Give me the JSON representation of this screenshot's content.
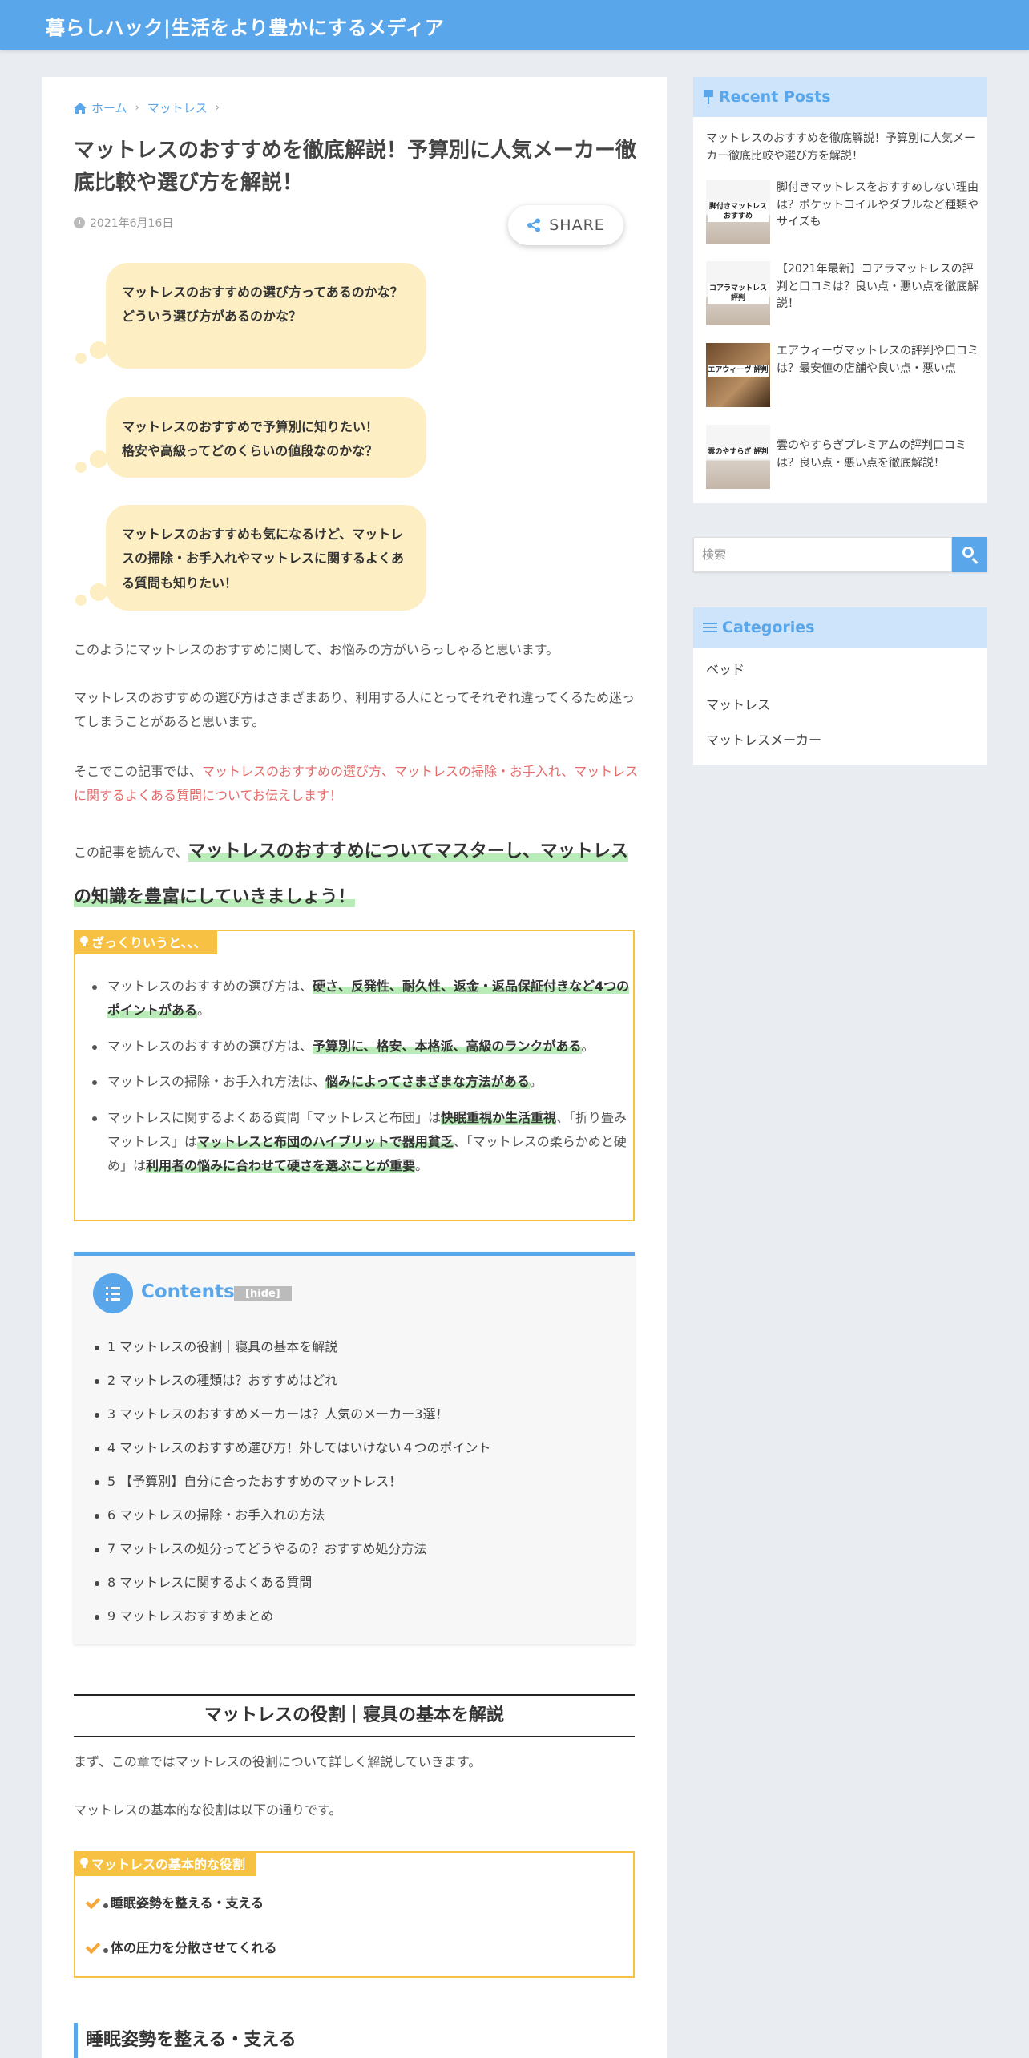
{
  "site": {
    "title": "暮らしハック|生活をより豊かにするメディア"
  },
  "breadcrumb": {
    "home": "ホーム",
    "category": "マットレス"
  },
  "article": {
    "title": "マットレスのおすすめを徹底解説！予算別に人気メーカー徹底比較や選び方を解説！",
    "date": "2021年6月16日",
    "share_label": "SHARE",
    "bubbles": [
      [
        "マットレスのおすすめの選び方ってあるのかな？",
        "どういう選び方があるのかな？"
      ],
      [
        "マットレスのおすすめで予算別に知りたい！",
        "格安や高級ってどのくらいの値段なのかな？"
      ],
      [
        "マットレスのおすすめも気になるけど、マットレスの掃除・お手入れやマットレスに関するよくある質問も知りたい！"
      ]
    ],
    "para1": "このようにマットレスのおすすめに関して、お悩みの方がいらっしゃると思います。",
    "para2": "マットレスのおすすめの選び方はさまざまあり、利用する人にとってそれぞれ違ってくるため迷ってしまうことがあると思います。",
    "para3_prefix": "そこでこの記事では、",
    "para3_red": "マットレスのおすすめの選び方、マットレスの掃除・お手入れ、マットレスに関するよくある質問についてお伝えします！",
    "lead_prefix": "この記事を読んで、",
    "lead_big": "マットレスのおすすめについてマスターし、マットレスの知識を豊富にしていきましょう！",
    "summary": {
      "label": "ざっくりいうと、、、",
      "items": [
        {
          "pre": "マットレスのおすすめの選び方は、",
          "mark": "硬さ、反発性、耐久性、返金・返品保証付きなど4つのポイントがある",
          "post": "。"
        },
        {
          "pre": "マットレスのおすすめの選び方は、",
          "mark": "予算別に、格安、本格派、高級のランクがある",
          "post": "。"
        },
        {
          "pre": "マットレスの掃除・お手入れ方法は、",
          "mark": "悩みによってさまざまな方法がある",
          "post": "。"
        }
      ],
      "item4": {
        "a": "マットレスに関するよくある質問「マットレスと布団」は",
        "b": "快眠重視か生活重視",
        "c": "、「折り畳みマットレス」は",
        "d": "マットレスと布団のハイブリットで器用貧乏",
        "e": "、「マットレスの柔らかめと硬め」は",
        "f": "利用者の悩みに合わせて硬さを選ぶことが重要",
        "g": "。"
      }
    },
    "toc": {
      "title": "Contents",
      "hide_label": "[hide]",
      "items": [
        "1 マットレスの役割｜寝具の基本を解説",
        "2 マットレスの種類は？おすすめはどれ",
        "3 マットレスのおすすめメーカーは？人気のメーカー3選！",
        "4 マットレスのおすすめ選び方！外してはいけない４つのポイント",
        "5 【予算別】自分に合ったおすすめのマットレス！",
        "6 マットレスの掃除・お手入れの方法",
        "7 マットレスの処分ってどうやるの？おすすめ処分方法",
        "8 マットレスに関するよくある質問",
        "9 マットレスおすすめまとめ"
      ]
    },
    "h2": "マットレスの役割｜寝具の基本を解説",
    "para4": "まず、この章ではマットレスの役割について詳しく解説していきます。",
    "para5": "マットレスの基本的な役割は以下の通りです。",
    "roles": {
      "label": "マットレスの基本的な役割",
      "items": [
        "睡眠姿勢を整える・支える",
        "体の圧力を分散させてくれる"
      ]
    },
    "h3": "睡眠姿勢を整える・支える"
  },
  "sidebar": {
    "recent_title": "Recent Posts",
    "first_post": "マットレスのおすすめを徹底解説！予算別に人気メーカー徹底比較や選び方を解説！",
    "posts": [
      {
        "thumb": "脚付きマットレス おすすめ",
        "title": "脚付きマットレスをおすすめしない理由は？ポケットコイルやダブルなど種類やサイズも"
      },
      {
        "thumb": "コアラマットレス 評判",
        "title": "【2021年最新】コアラマットレスの評判と口コミは？良い点・悪い点を徹底解説！"
      },
      {
        "thumb": "エアウィーヴ 評判",
        "title": "エアウィーヴマットレスの評判や口コミは？最安値の店舗や良い点・悪い点"
      },
      {
        "thumb": "雲のやすらぎ 評判",
        "title": "雲のやすらぎプレミアムの評判口コミは？良い点・悪い点を徹底解説！"
      }
    ],
    "search_placeholder": "検索",
    "categories_title": "Categories",
    "categories": [
      "ベッド",
      "マットレス",
      "マットレスメーカー"
    ]
  },
  "colors": {
    "accent": "#5aa6ea",
    "bubble": "#fdefc3",
    "box_border": "#f7c244",
    "marker": "#b9ecb9",
    "red": "#e66a6a"
  }
}
